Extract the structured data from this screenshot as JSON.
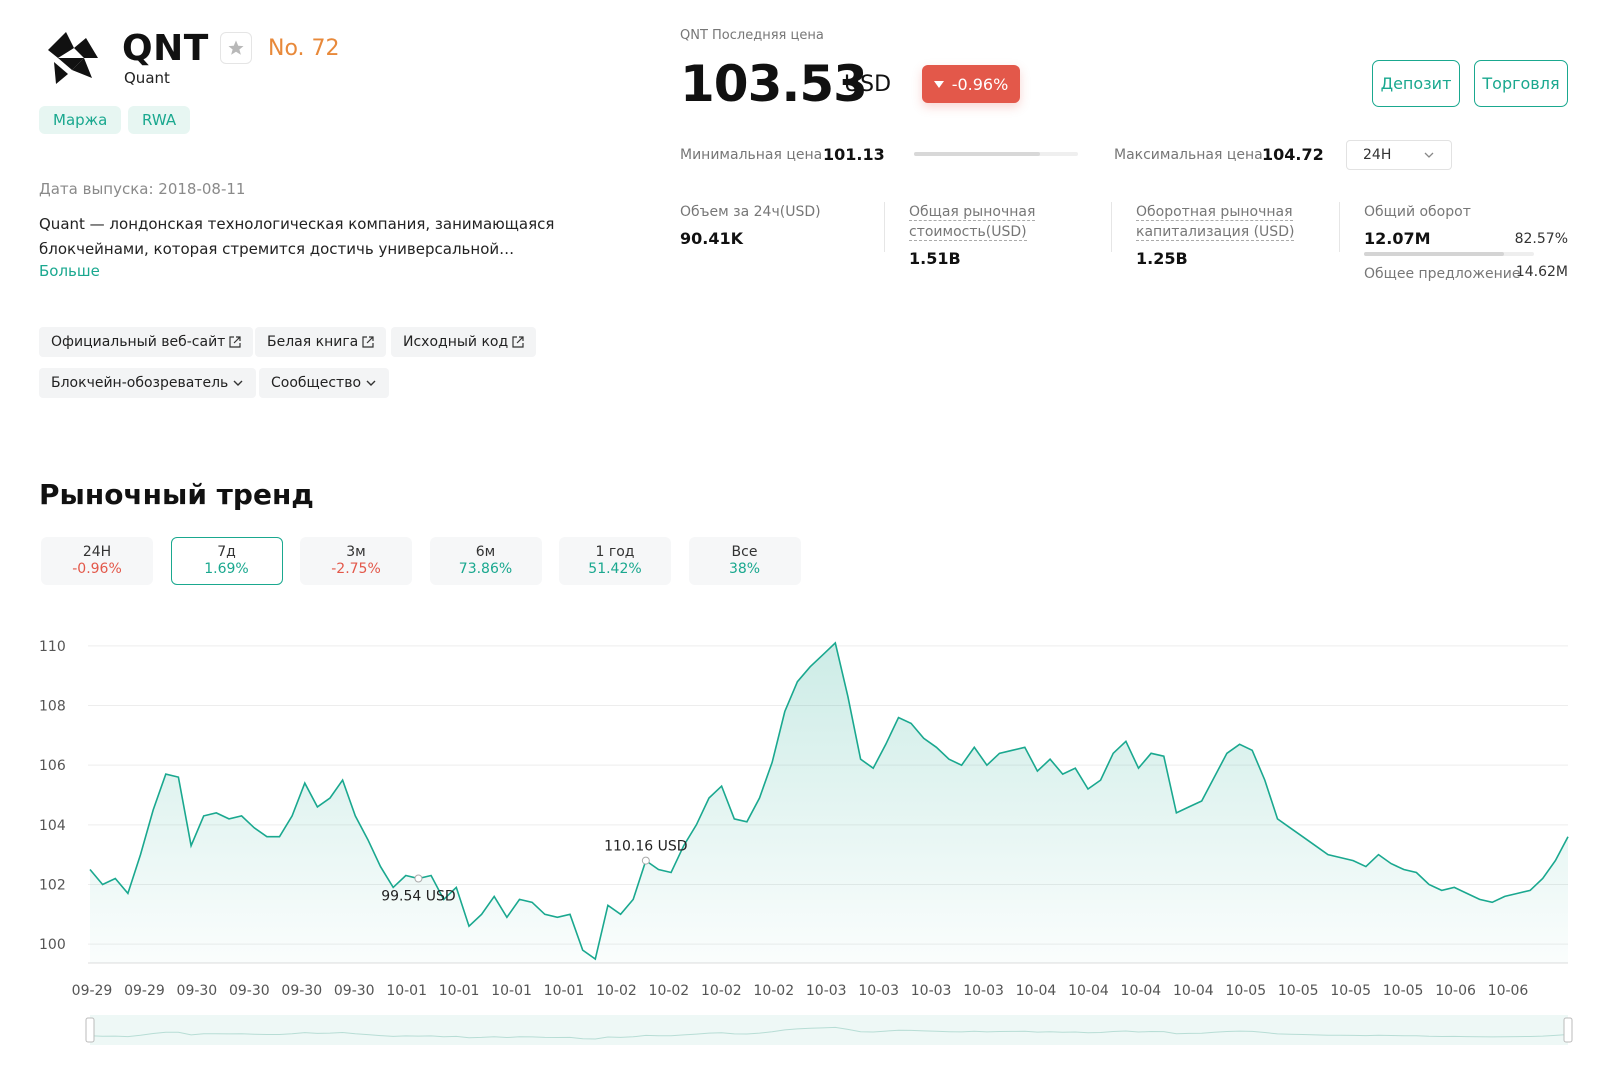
{
  "coin": {
    "symbol": "QNT",
    "name": "Quant",
    "rank": "No. 72",
    "tags": [
      "Маржа",
      "RWA"
    ],
    "release_date": "Дата выпуска: 2018-08-11",
    "description": "Quant — лондонская технологическая компания, занимающаяся блокчейнами, которая стремится достичь универсальной…",
    "more_label": "Больше",
    "links": [
      "Официальный веб-сайт",
      "Белая книга",
      "Исходный код"
    ],
    "dropdowns": [
      "Блокчейн-обозреватель",
      "Сообщество"
    ]
  },
  "price": {
    "label": "QNT Последняя цена",
    "value": "103.53",
    "unit": "USD",
    "change": "-0.96%",
    "deposit_label": "Депозит",
    "trade_label": "Торговля",
    "min_label": "Минимальная цена",
    "min_value": "101.13",
    "max_label": "Максимальная цена",
    "max_value": "104.72",
    "period": "24H",
    "range_fill_fraction": 0.77
  },
  "stats": {
    "volume_label": "Объем за 24ч(USD)",
    "volume_value": "90.41K",
    "mcap_label_1": "Общая рыночная",
    "mcap_label_2": "стоимость(USD)",
    "mcap_value": "1.51B",
    "circ_label_1": "Оборотная рыночная",
    "circ_label_2": "капитализация (USD)",
    "circ_value": "1.25B",
    "turnover_label": "Общий оборот",
    "turnover_value": "12.07M",
    "turnover_percent": "82.57%",
    "turnover_fraction": 0.8257,
    "supply_label": "Общее предложение",
    "supply_value": "14.62M"
  },
  "trend": {
    "title": "Рыночный тренд",
    "periods": [
      {
        "label": "24H",
        "change": "-0.96%",
        "dir": "neg"
      },
      {
        "label": "7д",
        "change": "1.69%",
        "dir": "pos"
      },
      {
        "label": "3м",
        "change": "-2.75%",
        "dir": "neg"
      },
      {
        "label": "6м",
        "change": "73.86%",
        "dir": "pos"
      },
      {
        "label": "1 год",
        "change": "51.42%",
        "dir": "pos"
      },
      {
        "label": "Все",
        "change": "38%",
        "dir": "pos"
      }
    ],
    "active_period": 1
  },
  "colors": {
    "accent": "#1aa88f",
    "negative": "#e3584a",
    "rank": "#e8893a"
  },
  "chart_data": {
    "type": "area",
    "ylim": [
      99.5,
      110.5
    ],
    "yticks": [
      100,
      102,
      104,
      106,
      108,
      110
    ],
    "xlabels": [
      "09-29",
      "09-29",
      "09-30",
      "09-30",
      "09-30",
      "09-30",
      "10-01",
      "10-01",
      "10-01",
      "10-01",
      "10-02",
      "10-02",
      "10-02",
      "10-02",
      "10-03",
      "10-03",
      "10-03",
      "10-03",
      "10-04",
      "10-04",
      "10-04",
      "10-04",
      "10-05",
      "10-05",
      "10-05",
      "10-05",
      "10-06",
      "10-06"
    ],
    "max_label": "110.16 USD",
    "min_label": "99.54 USD",
    "max_index": 44,
    "min_index": 26,
    "series": [
      {
        "values": [
          102.5,
          102.0,
          102.2,
          101.7,
          103.0,
          104.5,
          105.7,
          105.6,
          103.3,
          104.3,
          104.4,
          104.2,
          104.3,
          103.9,
          103.6,
          103.6,
          104.3,
          105.4,
          104.6,
          104.9,
          105.5,
          104.3,
          103.5,
          102.6,
          101.9,
          102.3,
          102.2,
          102.3,
          101.5,
          101.9,
          100.6,
          101.0,
          101.6,
          100.9,
          101.5,
          101.4,
          101.0,
          100.9,
          101.0,
          99.8,
          99.5,
          101.3,
          101.0,
          101.5,
          102.8,
          102.5,
          102.4,
          103.3,
          104.0,
          104.9,
          105.3,
          104.2,
          104.1,
          104.9,
          106.1,
          107.8,
          108.8,
          109.3,
          109.7,
          110.1,
          108.3,
          106.2,
          105.9,
          106.7,
          107.6,
          107.4,
          106.9,
          106.6,
          106.2,
          106.0,
          106.6,
          106.0,
          106.4,
          106.5,
          106.6,
          105.8,
          106.2,
          105.7,
          105.9,
          105.2,
          105.5,
          106.4,
          106.8,
          105.9,
          106.4,
          106.3,
          104.4,
          104.6,
          104.8,
          105.6,
          106.4,
          106.7,
          106.5,
          105.5,
          104.2,
          103.9,
          103.6,
          103.3,
          103.0,
          102.9,
          102.8,
          102.6,
          103.0,
          102.7,
          102.5,
          102.4,
          102.0,
          101.8,
          101.9,
          101.7,
          101.5,
          101.4,
          101.6,
          101.7,
          101.8,
          102.2,
          102.8,
          103.6
        ]
      }
    ]
  }
}
